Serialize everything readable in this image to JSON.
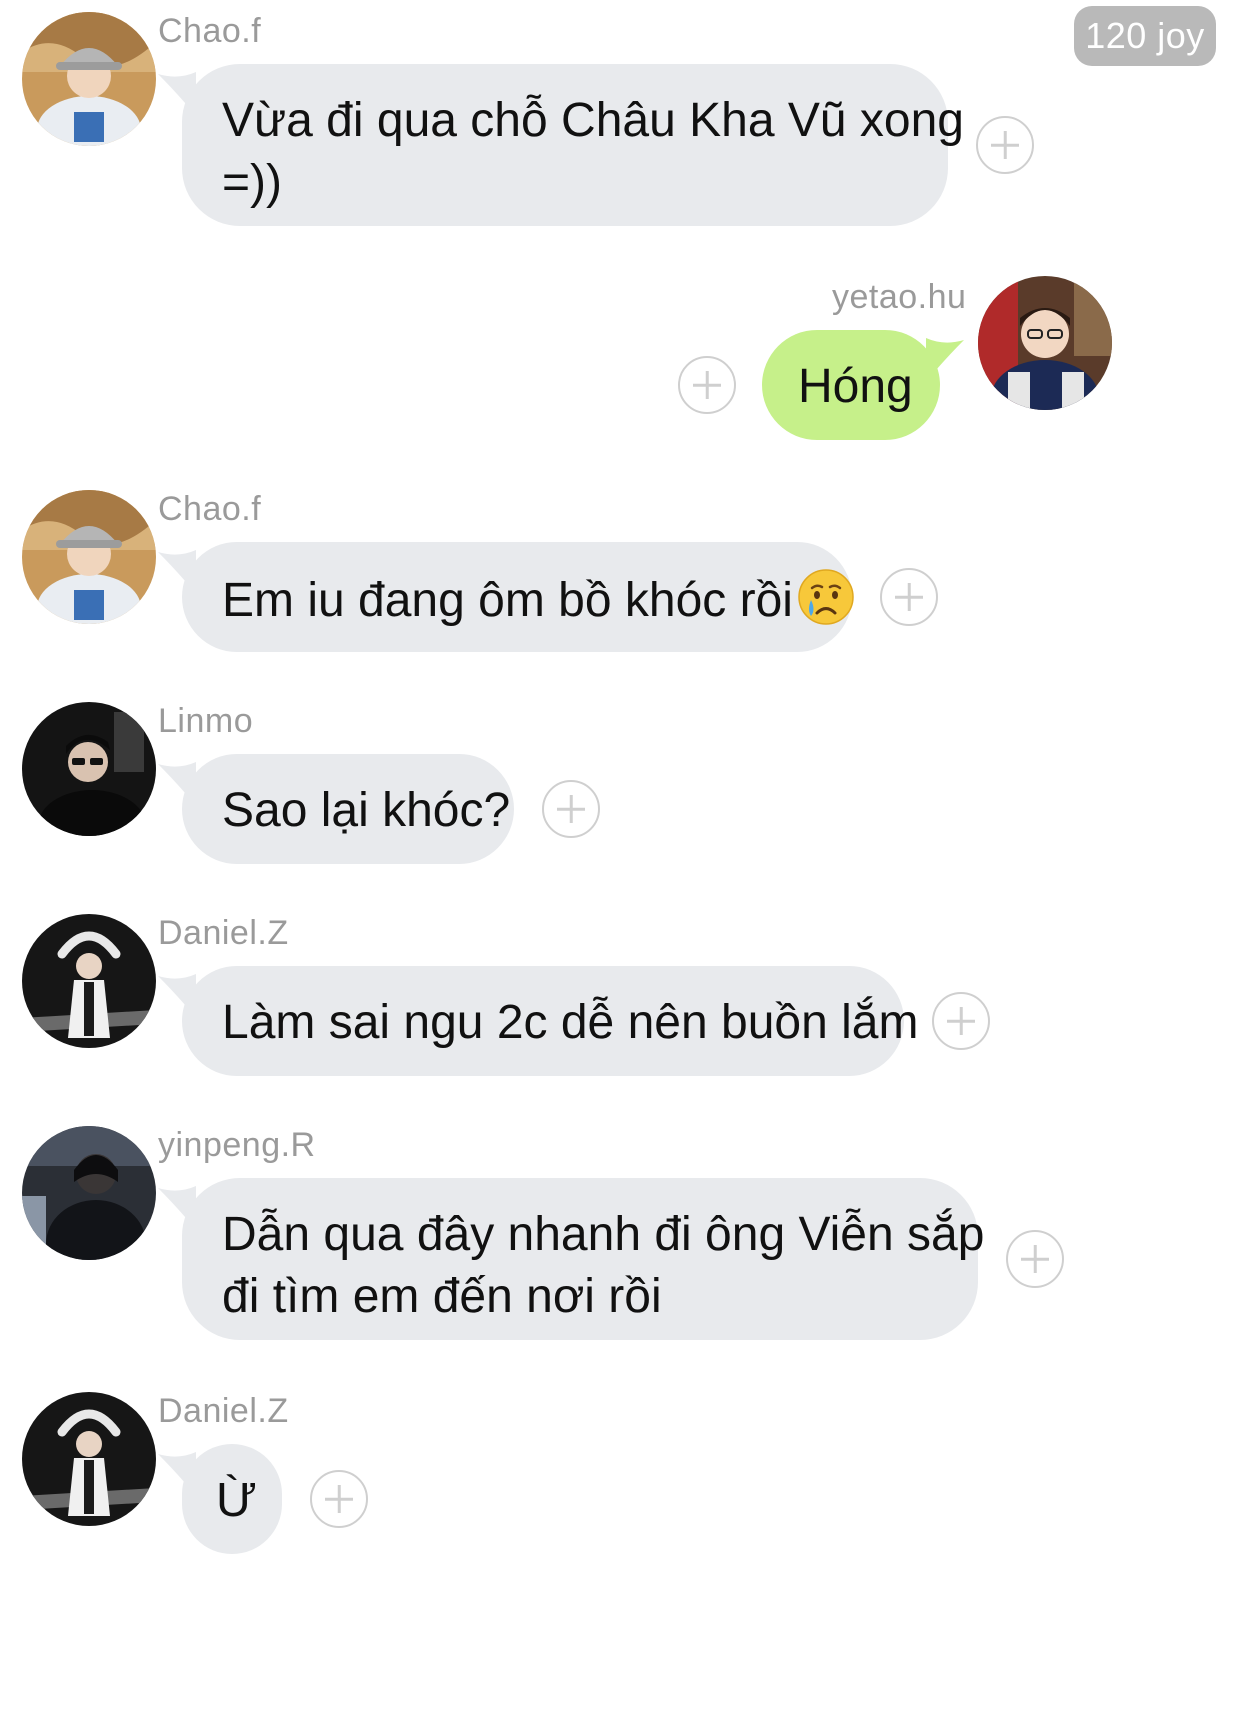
{
  "header": {
    "joy_badge": "120 joy"
  },
  "messages": [
    {
      "sender": "Chao.f",
      "text": "Vừa đi qua chỗ Châu Kha Vũ xong =))",
      "line1": "Vừa đi qua chỗ Châu Kha Vũ xong",
      "line2": "=))"
    },
    {
      "sender": "yetao.hu",
      "text": "Hóng"
    },
    {
      "sender": "Chao.f",
      "text": "Em iu đang ôm bồ khóc rồi",
      "emoji": "crying-face"
    },
    {
      "sender": "Linmo",
      "text": "Sao lại khóc?"
    },
    {
      "sender": "Daniel.Z",
      "text": "Làm sai ngu 2c dễ nên buồn lắm"
    },
    {
      "sender": "yinpeng.R",
      "text": "Dẫn qua đây nhanh đi ông Viễn sắp đi tìm em đến nơi rồi",
      "line1": "Dẫn qua đây nhanh đi ông Viễn sắp",
      "line2": "đi tìm em đến nơi rồi"
    },
    {
      "sender": "Daniel.Z",
      "text": "Ừ"
    }
  ],
  "colors": {
    "incoming_bubble": "#e8eaed",
    "outgoing_bubble": "#c6f08a",
    "sender_name": "#9a9a9a",
    "badge": "#b9b9b9"
  }
}
